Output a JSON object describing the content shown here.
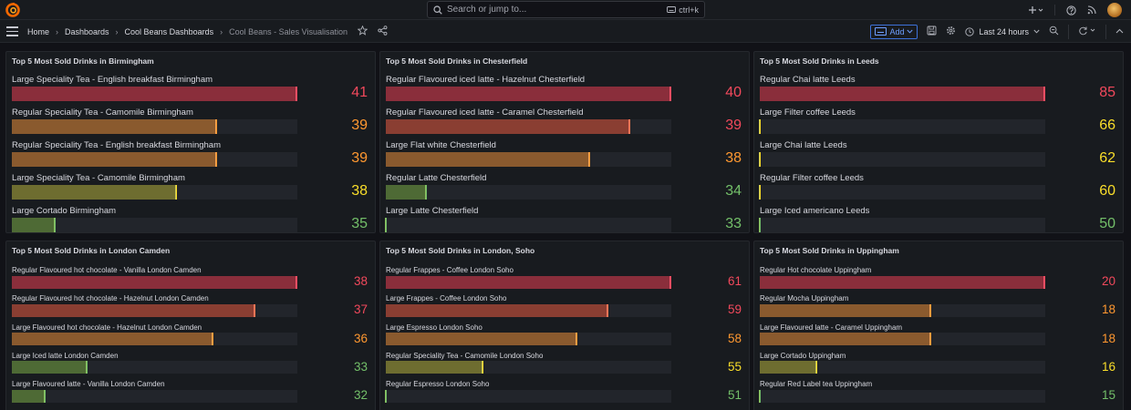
{
  "topbar": {
    "search_placeholder": "Search or jump to...",
    "search_shortcut": "ctrl+k",
    "icons": [
      "grafana-logo-icon",
      "plus-icon",
      "help-icon",
      "rss-icon",
      "avatar"
    ]
  },
  "nav": {
    "breadcrumbs": [
      "Home",
      "Dashboards",
      "Cool Beans Dashboards",
      "Cool Beans - Sales Visualisation"
    ],
    "add_label": "Add",
    "time_range": "Last 24 hours"
  },
  "colors": {
    "red": "#f2495c",
    "orange": "#ff9830",
    "yellow": "#fade2a",
    "green": "#73bf69"
  },
  "panels": [
    {
      "title": "Top 5 Most Sold Drinks in Birmingham",
      "max": 41,
      "rows": [
        {
          "label": "Large Speciality Tea - English breakfast Birmingham",
          "value": 41,
          "level": "red"
        },
        {
          "label": "Regular Speciality Tea - Camomile Birmingham",
          "value": 39,
          "level": "orange"
        },
        {
          "label": "Regular Speciality Tea - English breakfast Birmingham",
          "value": 39,
          "level": "orange"
        },
        {
          "label": "Large Speciality Tea - Camomile Birmingham",
          "value": 38,
          "level": "yellow"
        },
        {
          "label": "Large Cortado Birmingham",
          "value": 35,
          "level": "green"
        }
      ]
    },
    {
      "title": "Top 5 Most Sold Drinks in Chesterfield",
      "max": 40,
      "rows": [
        {
          "label": "Regular Flavoured iced latte - Hazelnut Chesterfield",
          "value": 40,
          "level": "red"
        },
        {
          "label": "Regular Flavoured iced latte - Caramel Chesterfield",
          "value": 39,
          "level": "red2"
        },
        {
          "label": "Large Flat white Chesterfield",
          "value": 38,
          "level": "orange"
        },
        {
          "label": "Regular Latte Chesterfield",
          "value": 34,
          "level": "green"
        },
        {
          "label": "Large Latte Chesterfield",
          "value": 33,
          "level": "green"
        }
      ]
    },
    {
      "title": "Top 5 Most Sold Drinks in Leeds",
      "max": 85,
      "rows": [
        {
          "label": "Regular Chai latte Leeds",
          "value": 85,
          "level": "red"
        },
        {
          "label": "Large Filter coffee Leeds",
          "value": 66,
          "level": "yellow"
        },
        {
          "label": "Large Chai latte Leeds",
          "value": 62,
          "level": "yellow"
        },
        {
          "label": "Regular Filter coffee Leeds",
          "value": 60,
          "level": "yellow"
        },
        {
          "label": "Large Iced americano Leeds",
          "value": 50,
          "level": "green"
        }
      ]
    },
    {
      "title": "Top 5 Most Sold Drinks in London Camden",
      "max": 38,
      "rows": [
        {
          "label": "Regular Flavoured hot chocolate - Vanilla London Camden",
          "value": 38,
          "level": "red"
        },
        {
          "label": "Regular Flavoured hot chocolate - Hazelnut London Camden",
          "value": 37,
          "level": "red2"
        },
        {
          "label": "Large Flavoured hot chocolate - Hazelnut London Camden",
          "value": 36,
          "level": "orange"
        },
        {
          "label": "Large Iced latte London Camden",
          "value": 33,
          "level": "green"
        },
        {
          "label": "Large Flavoured latte - Vanilla London Camden",
          "value": 32,
          "level": "green"
        }
      ]
    },
    {
      "title": "Top 5 Most Sold Drinks in London, Soho",
      "max": 61,
      "rows": [
        {
          "label": "Regular Frappes - Coffee London Soho",
          "value": 61,
          "level": "red"
        },
        {
          "label": "Large Frappes - Coffee London Soho",
          "value": 59,
          "level": "red2"
        },
        {
          "label": "Large Espresso London Soho",
          "value": 58,
          "level": "orange"
        },
        {
          "label": "Regular Speciality Tea - Camomile London Soho",
          "value": 55,
          "level": "yellow"
        },
        {
          "label": "Regular Espresso London Soho",
          "value": 51,
          "level": "green"
        }
      ]
    },
    {
      "title": "Top 5 Most Sold Drinks in Uppingham",
      "max": 20,
      "rows": [
        {
          "label": "Regular Hot chocolate Uppingham",
          "value": 20,
          "level": "red"
        },
        {
          "label": "Regular Mocha Uppingham",
          "value": 18,
          "level": "orange"
        },
        {
          "label": "Large Flavoured latte - Caramel Uppingham",
          "value": 18,
          "level": "orange"
        },
        {
          "label": "Large Cortado Uppingham",
          "value": 16,
          "level": "yellow"
        },
        {
          "label": "Regular Red Label tea Uppingham",
          "value": 15,
          "level": "green"
        }
      ]
    }
  ]
}
